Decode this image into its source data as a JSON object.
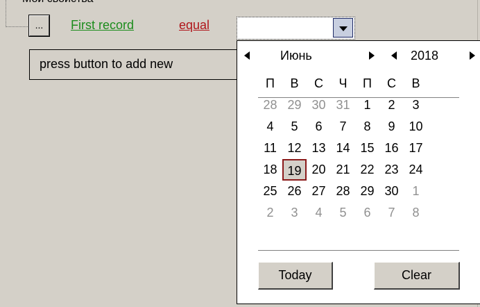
{
  "tree": {
    "top_partial_text": "Мои свойства",
    "ellipsis_label": "...",
    "field_link": "First record",
    "operator_link": "equal",
    "value_input": "",
    "hint": "press button to add new"
  },
  "calendar": {
    "month": "Июнь",
    "year": "2018",
    "weekdays": [
      "П",
      "В",
      "С",
      "Ч",
      "П",
      "С",
      "В"
    ],
    "weeks": [
      [
        {
          "d": "28",
          "o": true
        },
        {
          "d": "29",
          "o": true
        },
        {
          "d": "30",
          "o": true
        },
        {
          "d": "31",
          "o": true
        },
        {
          "d": "1",
          "o": false
        },
        {
          "d": "2",
          "o": false
        },
        {
          "d": "3",
          "o": false
        }
      ],
      [
        {
          "d": "4",
          "o": false
        },
        {
          "d": "5",
          "o": false
        },
        {
          "d": "6",
          "o": false
        },
        {
          "d": "7",
          "o": false
        },
        {
          "d": "8",
          "o": false
        },
        {
          "d": "9",
          "o": false
        },
        {
          "d": "10",
          "o": false
        }
      ],
      [
        {
          "d": "11",
          "o": false
        },
        {
          "d": "12",
          "o": false
        },
        {
          "d": "13",
          "o": false
        },
        {
          "d": "14",
          "o": false
        },
        {
          "d": "15",
          "o": false
        },
        {
          "d": "16",
          "o": false
        },
        {
          "d": "17",
          "o": false
        }
      ],
      [
        {
          "d": "18",
          "o": false
        },
        {
          "d": "19",
          "o": false,
          "today": true
        },
        {
          "d": "20",
          "o": false
        },
        {
          "d": "21",
          "o": false
        },
        {
          "d": "22",
          "o": false
        },
        {
          "d": "23",
          "o": false
        },
        {
          "d": "24",
          "o": false
        }
      ],
      [
        {
          "d": "25",
          "o": false
        },
        {
          "d": "26",
          "o": false
        },
        {
          "d": "27",
          "o": false
        },
        {
          "d": "28",
          "o": false
        },
        {
          "d": "29",
          "o": false
        },
        {
          "d": "30",
          "o": false
        },
        {
          "d": "1",
          "o": true
        }
      ],
      [
        {
          "d": "2",
          "o": true
        },
        {
          "d": "3",
          "o": true
        },
        {
          "d": "4",
          "o": true
        },
        {
          "d": "5",
          "o": true
        },
        {
          "d": "6",
          "o": true
        },
        {
          "d": "7",
          "o": true
        },
        {
          "d": "8",
          "o": true
        }
      ]
    ],
    "today_label": "Today",
    "clear_label": "Clear"
  },
  "icons": {
    "dropdown": "chevron-down-icon",
    "prev_month": "triangle-left-icon",
    "next_month": "triangle-right-icon",
    "prev_year": "triangle-left-icon",
    "next_year": "triangle-right-icon"
  },
  "colors": {
    "field_link": "#1c8c1c",
    "operator_link": "#b0161b",
    "today_border": "#8b1a1a",
    "other_month_day": "#909090",
    "background": "#d4d0c8"
  }
}
